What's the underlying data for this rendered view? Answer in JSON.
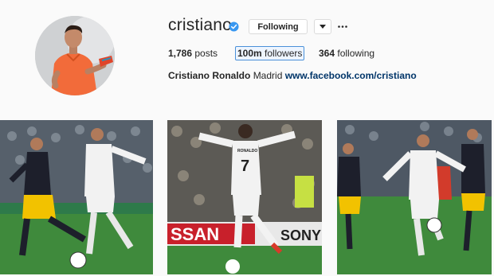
{
  "profile": {
    "username": "cristiano",
    "verified": true,
    "follow_button": "Following",
    "dropdown_icon": "caret-down-icon",
    "more_icon": "ellipsis-icon",
    "stats": {
      "posts_count": "1,786",
      "posts_label": "posts",
      "followers_count": "100m",
      "followers_label": "followers",
      "following_count": "364",
      "following_label": "following"
    },
    "bio": {
      "full_name": "Cristiano Ronaldo",
      "text": "Madrid",
      "link": "www.facebook.com/cristiano"
    }
  },
  "posts": {
    "items": [
      {
        "name": "post-1"
      },
      {
        "name": "post-2",
        "banner": "SSAN",
        "banner2": "SONY",
        "jersey": "7",
        "jersey_name": "RONALDO"
      },
      {
        "name": "post-3"
      }
    ]
  },
  "colors": {
    "background": "#fafafa",
    "verified_blue": "#3897f0",
    "link": "#003569",
    "madrid_white": "#f2f2f2",
    "atletico_dark": "#1d1f2b",
    "pitch": "#3f8a3c"
  }
}
